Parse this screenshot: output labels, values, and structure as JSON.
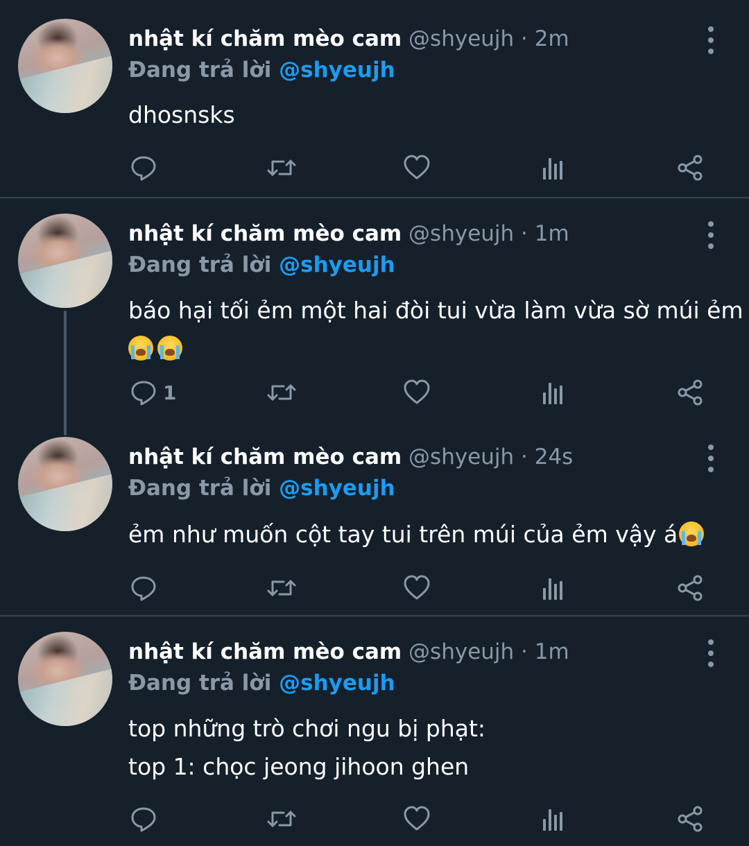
{
  "colors": {
    "background": "#15202b",
    "divider": "#38444d",
    "muted": "#8b98a5",
    "accent": "#1d9bf0"
  },
  "tweets": [
    {
      "display_name": "nhật kí chăm mèo cam",
      "handle": "@shyeujh",
      "separator": " · ",
      "time": "2m",
      "reply_label": "Đang trả lời",
      "reply_to": "@shyeujh",
      "lines": [
        "dhosnsks"
      ],
      "emojis": [],
      "reply_count": "",
      "icons": [
        "reply-icon",
        "retweet-icon",
        "like-icon",
        "analytics-icon",
        "share-icon"
      ]
    },
    {
      "display_name": "nhật kí chăm mèo cam",
      "handle": "@shyeujh",
      "separator": " · ",
      "time": "1m",
      "reply_label": "Đang trả lời",
      "reply_to": "@shyeujh",
      "lines": [
        "báo hại tối ẻm một hai đòi tui vừa làm vừa sờ múi ẻm"
      ],
      "emojis": [
        "loudly-crying-face",
        "loudly-crying-face"
      ],
      "reply_count": "1",
      "icons": [
        "reply-icon",
        "retweet-icon",
        "like-icon",
        "analytics-icon",
        "share-icon"
      ]
    },
    {
      "display_name": "nhật kí chăm mèo cam",
      "handle": "@shyeujh",
      "separator": " · ",
      "time": "24s",
      "reply_label": "Đang trả lời",
      "reply_to": "@shyeujh",
      "lines": [
        "ẻm như muốn cột tay tui trên múi của ẻm vậy á"
      ],
      "emojis": [
        "loudly-crying-face"
      ],
      "reply_count": "",
      "icons": [
        "reply-icon",
        "retweet-icon",
        "like-icon",
        "analytics-icon",
        "share-icon"
      ]
    },
    {
      "display_name": "nhật kí chăm mèo cam",
      "handle": "@shyeujh",
      "separator": " · ",
      "time": "1m",
      "reply_label": "Đang trả lời",
      "reply_to": "@shyeujh",
      "lines": [
        "top những trò chơi ngu bị phạt:",
        "top 1: chọc jeong jihoon ghen"
      ],
      "emojis": [],
      "reply_count": "",
      "icons": [
        "reply-icon",
        "retweet-icon",
        "like-icon",
        "analytics-icon",
        "share-icon"
      ]
    }
  ]
}
